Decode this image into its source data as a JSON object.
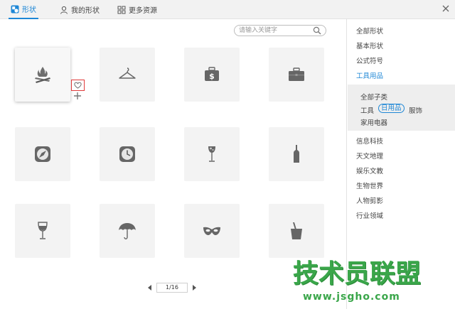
{
  "tabs": [
    {
      "label": "形状",
      "icon": "shape-icon",
      "active": true
    },
    {
      "label": "我的形状",
      "icon": "user-icon",
      "active": false
    },
    {
      "label": "更多资源",
      "icon": "grid-icon",
      "active": false
    }
  ],
  "search": {
    "placeholder": "请输入关键字"
  },
  "grid": {
    "items": [
      {
        "icon": "campfire-icon"
      },
      {
        "icon": "hanger-icon"
      },
      {
        "icon": "money-bag-icon"
      },
      {
        "icon": "briefcase-icon"
      },
      {
        "icon": "compass-icon"
      },
      {
        "icon": "clock-icon"
      },
      {
        "icon": "wine-glass-icon"
      },
      {
        "icon": "bottle-icon"
      },
      {
        "icon": "goblet-icon"
      },
      {
        "icon": "umbrella-icon"
      },
      {
        "icon": "mask-icon"
      },
      {
        "icon": "drink-cup-icon"
      }
    ],
    "selected_index": 0
  },
  "pagination": {
    "label": "1/16"
  },
  "sidebar": {
    "categories": [
      "全部形状",
      "基本形状",
      "公式符号",
      "工具用品"
    ],
    "active_category": "工具用品",
    "subcategories": {
      "all": "全部子类",
      "items": [
        "工具",
        "日用品",
        "服饰",
        "家用电器"
      ],
      "active": "日用品"
    },
    "more_categories": [
      "信息科技",
      "天文地理",
      "娱乐文教",
      "生物世界",
      "人物剪影",
      "行业领域"
    ]
  },
  "watermark": {
    "text": "技术员联盟",
    "url": "www.jsgho.com"
  },
  "colors": {
    "accent": "#1e87d6",
    "favorite_border": "#e03a3a",
    "watermark": "#3aa64a"
  }
}
